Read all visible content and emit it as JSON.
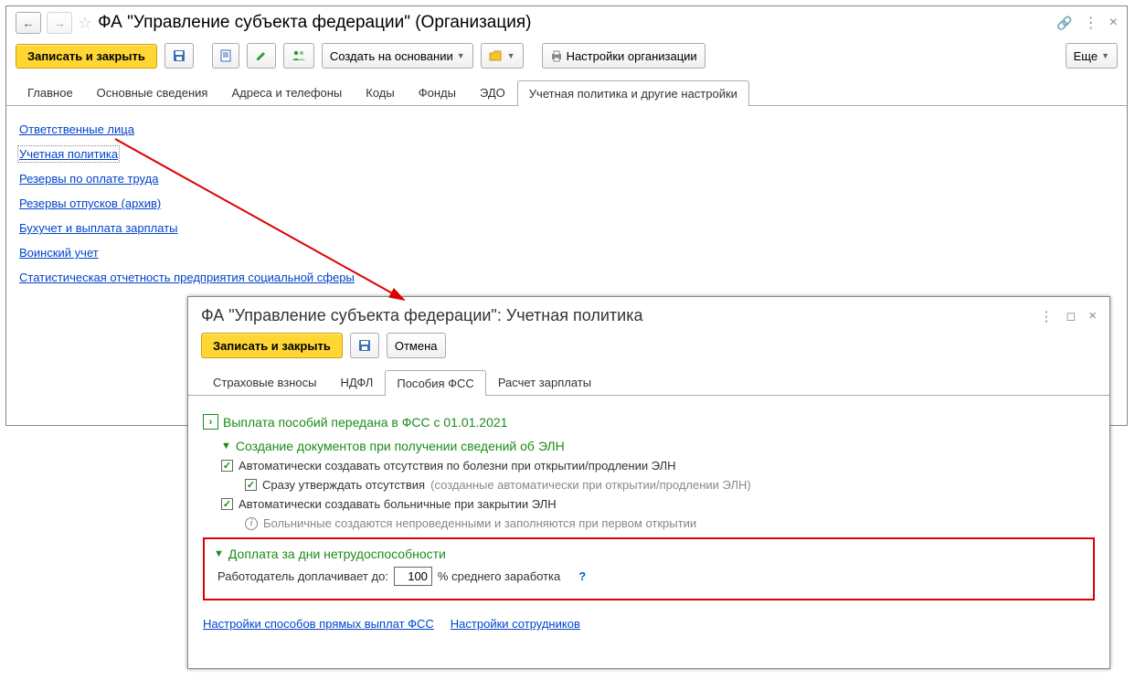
{
  "window1": {
    "title": "ФА \"Управление субъекта федерации\" (Организация)",
    "toolbar": {
      "save_close": "Записать и закрыть",
      "create_based_on": "Создать на основании",
      "org_settings": "Настройки организации",
      "more": "Еще"
    },
    "tabs": {
      "main": "Главное",
      "basic": "Основные сведения",
      "addresses": "Адреса и телефоны",
      "codes": "Коды",
      "funds": "Фонды",
      "edo": "ЭДО",
      "policy": "Учетная политика и другие настройки"
    },
    "links": {
      "responsible": "Ответственные лица",
      "policy": "Учетная политика",
      "reserves_labor": "Резервы по оплате труда",
      "reserves_vacation": "Резервы отпусков (архив)",
      "accounting": "Бухучет и выплата зарплаты",
      "military": "Воинский учет",
      "stats": "Статистическая отчетность предприятия социальной сферы"
    }
  },
  "window2": {
    "title": "ФА \"Управление субъекта федерации\": Учетная политика",
    "toolbar": {
      "save_close": "Записать и закрыть",
      "cancel": "Отмена"
    },
    "tabs": {
      "insurance": "Страховые взносы",
      "ndfl": "НДФЛ",
      "fss": "Пособия ФСС",
      "salary": "Расчет зарплаты"
    },
    "sections": {
      "fss_transfer": "Выплата пособий передана в ФСС с 01.01.2021",
      "eln_docs": "Создание документов при получении сведений об ЭЛН",
      "auto_absence": "Автоматически создавать отсутствия по болезни при открытии/продлении ЭЛН",
      "auto_confirm": "Сразу утверждать отсутствия",
      "auto_confirm_hint": "(созданные автоматически при открытии/продлении ЭЛН)",
      "auto_sick": "Автоматически создавать больничные при закрытии ЭЛН",
      "sick_hint": "Больничные создаются непроведенными и заполняются при первом открытии",
      "extra_pay": "Доплата за дни нетрудоспособности",
      "employer_pays_label": "Работодатель доплачивает до:",
      "employer_pays_value": "100",
      "percent_label": "% среднего заработка",
      "link_fss_methods": "Настройки способов прямых выплат ФСС",
      "link_employees": "Настройки сотрудников"
    }
  }
}
